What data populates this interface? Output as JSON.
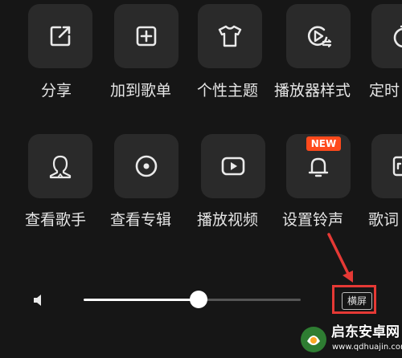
{
  "menu": {
    "row1": [
      {
        "label": "分享",
        "icon": "share-icon"
      },
      {
        "label": "加到歌单",
        "icon": "add-to-playlist-icon"
      },
      {
        "label": "个性主题",
        "icon": "theme-shirt-icon"
      },
      {
        "label": "播放器样式",
        "icon": "player-style-icon"
      },
      {
        "label": "定时",
        "icon": "timer-icon"
      }
    ],
    "row2": [
      {
        "label": "查看歌手",
        "icon": "singer-icon"
      },
      {
        "label": "查看专辑",
        "icon": "album-icon"
      },
      {
        "label": "播放视频",
        "icon": "video-play-icon"
      },
      {
        "label": "设置铃声",
        "icon": "ringtone-bell-icon",
        "badge": "NEW"
      },
      {
        "label": "歌词",
        "icon": "lyrics-icon"
      }
    ]
  },
  "volume": {
    "icon": "volume-icon",
    "level": 0.53
  },
  "landscape_button": {
    "label": "横屏"
  },
  "watermark": {
    "title": "启东安卓网",
    "url": "www.qdhuajin.com"
  },
  "colors": {
    "background": "#161616",
    "tile": "#2a2a2a",
    "badge": "#ff4a1c",
    "highlight": "#e53935",
    "slider_fill": "#ffffff",
    "slider_track": "#555555"
  }
}
